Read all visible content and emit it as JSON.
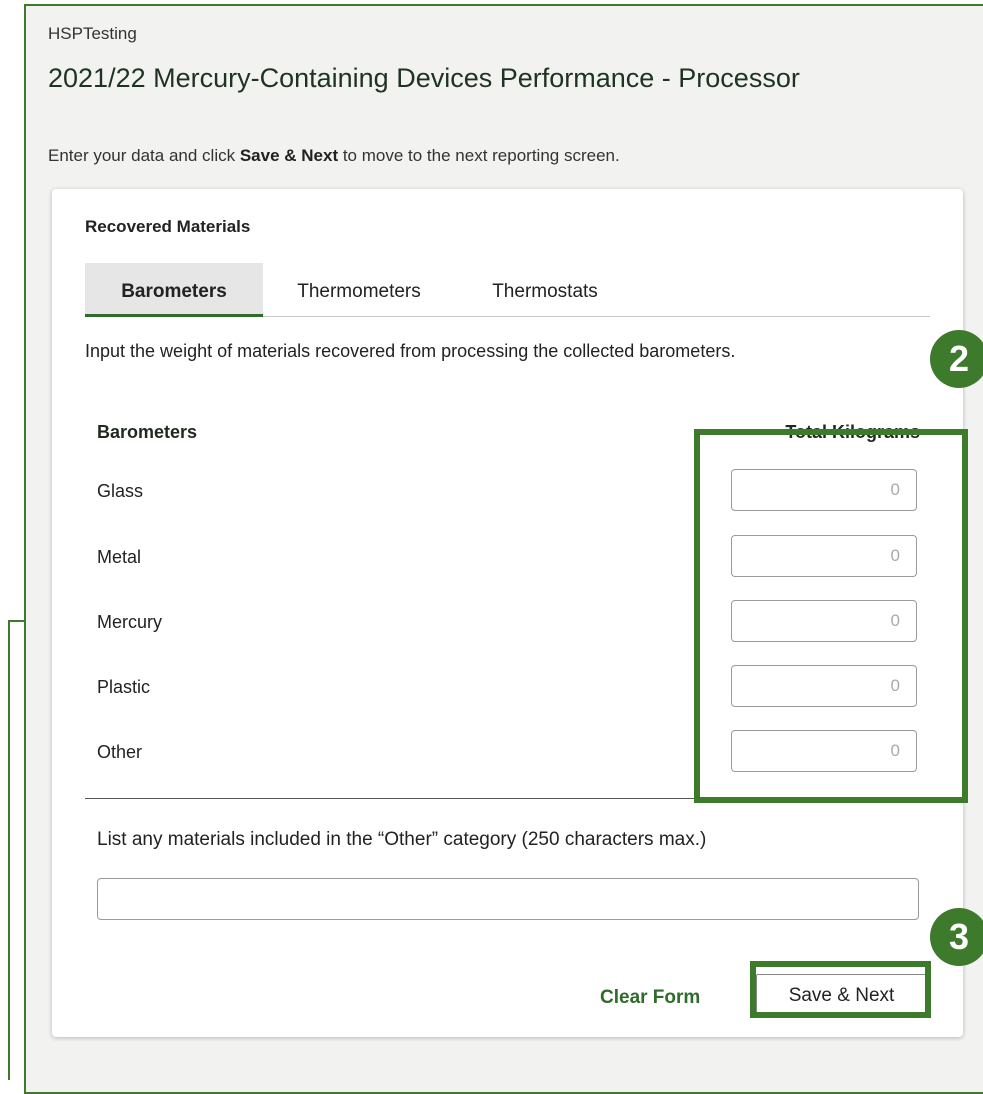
{
  "header": {
    "org_name": "HSPTesting",
    "title": "2021/22 Mercury-Containing Devices Performance - Processor",
    "instructions_prefix": "Enter your data and click ",
    "instructions_bold": "Save & Next",
    "instructions_suffix": " to move to the next reporting screen."
  },
  "card": {
    "section_title": "Recovered Materials",
    "tabs": [
      {
        "label": "Barometers",
        "active": true
      },
      {
        "label": "Thermometers",
        "active": false
      },
      {
        "label": "Thermostats",
        "active": false
      }
    ],
    "description": "Input the weight of materials recovered from processing the collected barometers.",
    "columns": {
      "name": "Barometers",
      "value": "Total Kilograms"
    },
    "rows": [
      {
        "label": "Glass",
        "placeholder": "0"
      },
      {
        "label": "Metal",
        "placeholder": "0"
      },
      {
        "label": "Mercury",
        "placeholder": "0"
      },
      {
        "label": "Plastic",
        "placeholder": "0"
      },
      {
        "label": "Other",
        "placeholder": "0"
      }
    ],
    "other_label": "List any materials included in the “Other” category (250 characters max.)",
    "other_value": "",
    "clear_label": "Clear Form",
    "save_label": "Save & Next"
  },
  "annotations": {
    "callout_2": "2",
    "callout_3": "3",
    "color": "#3e7a2c"
  }
}
